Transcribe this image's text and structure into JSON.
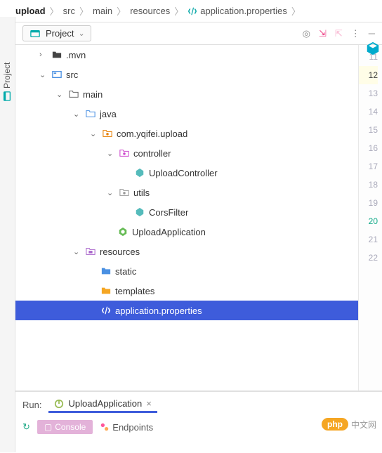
{
  "breadcrumb": {
    "root": "upload",
    "parts": [
      "src",
      "main",
      "resources",
      "application.properties"
    ]
  },
  "sideRail": {
    "label": "Project"
  },
  "toolbar": {
    "projectLabel": "Project"
  },
  "tree": {
    "mvn": ".mvn",
    "src": "src",
    "main": "main",
    "java": "java",
    "pkg": "com.yqifei.upload",
    "controller": "controller",
    "uploadController": "UploadController",
    "utils": "utils",
    "corsFilter": "CorsFilter",
    "uploadApplication": "UploadApplication",
    "resources": "resources",
    "static": "static",
    "templates": "templates",
    "appProps": "application.properties"
  },
  "gutter": {
    "start": 11,
    "end": 22,
    "active": 12
  },
  "run": {
    "label": "Run:",
    "app": "UploadApplication",
    "console": "Console",
    "endpoints": "Endpoints"
  },
  "badge": {
    "php": "php",
    "cn": "中文网"
  }
}
